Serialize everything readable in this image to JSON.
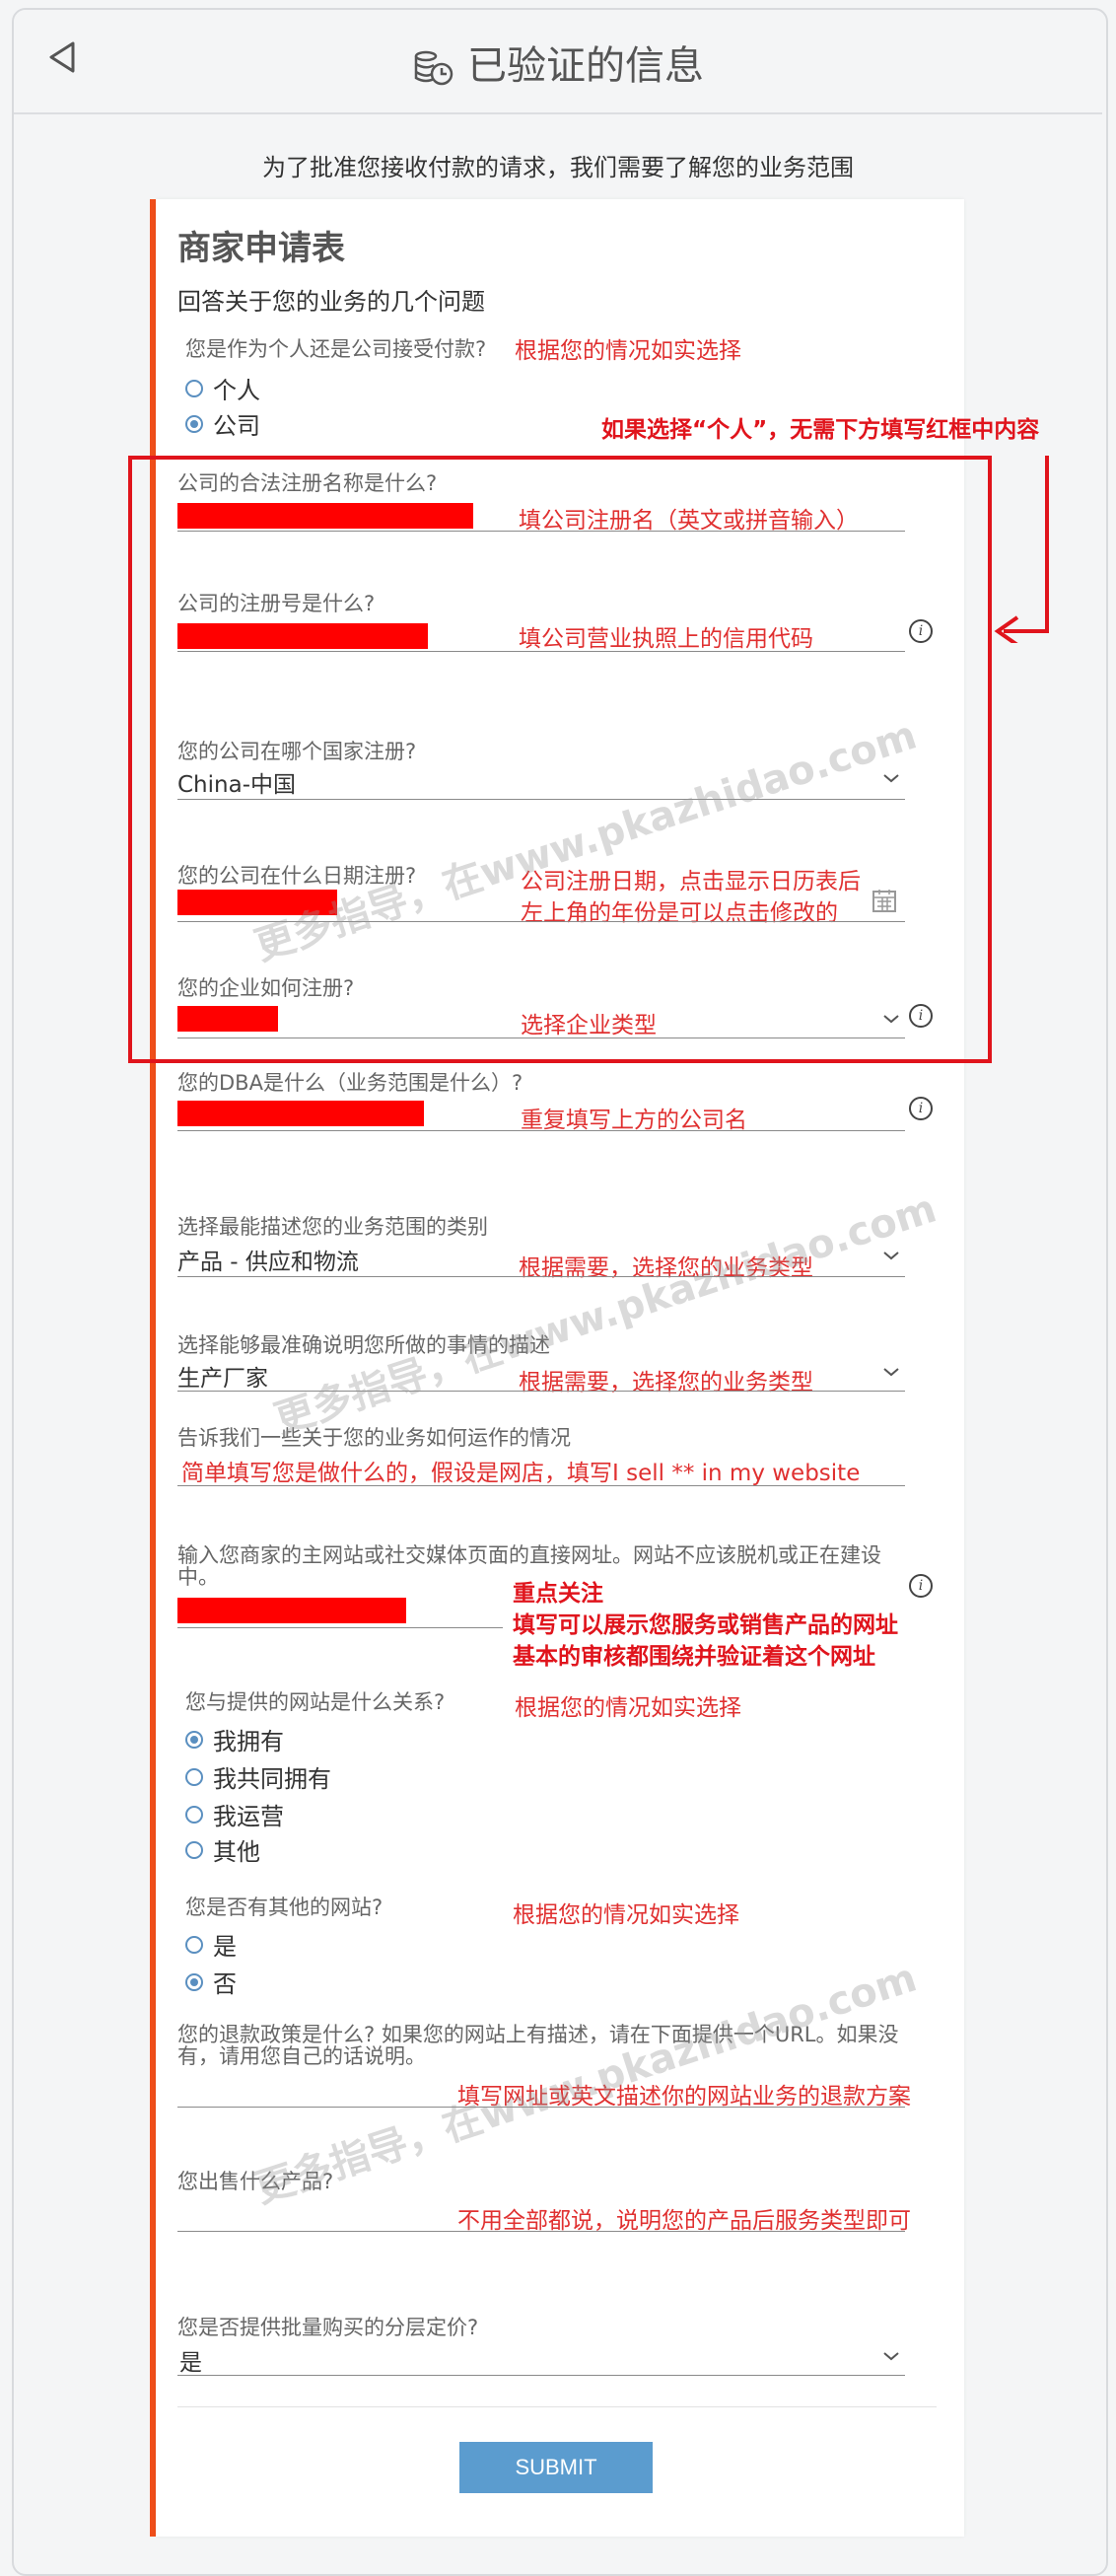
{
  "header": {
    "title": "已验证的信息"
  },
  "subtitle": "为了批准您接收付款的请求，我们需要了解您的业务范围",
  "form": {
    "title": "商家申请表",
    "subtitle": "回答关于您的业务的几个问题",
    "q_account_type": "您是作为个人还是公司接受付款?",
    "note_account_type": "根据您的情况如实选择",
    "opt_individual": "个人",
    "opt_company": "公司",
    "note_redbox": "如果选择“个人”，无需下方填写红框中内容",
    "q_legal_name": "公司的合法注册名称是什么?",
    "note_legal_name": "填公司注册名（英文或拼音输入）",
    "q_reg_number": "公司的注册号是什么?",
    "note_reg_number": "填公司营业执照上的信用代码",
    "q_country": "您的公司在哪个国家注册?",
    "country_value": "China-中国",
    "q_date": "您的公司在什么日期注册?",
    "note_date_1": "公司注册日期，点击显示日历表后",
    "note_date_2": "左上角的年份是可以点击修改的",
    "q_entity": "您的企业如何注册?",
    "note_entity": "选择企业类型",
    "q_dba": "您的DBA是什么（业务范围是什么）?",
    "note_dba": "重复填写上方的公司名",
    "q_category": "选择最能描述您的业务范围的类别",
    "category_value": "产品 - 供应和物流",
    "note_category": "根据需要，选择您的业务类型",
    "q_subcategory": "选择能够最准确说明您所做的事情的描述",
    "subcategory_value": "生产厂家",
    "note_subcategory": "根据需要，选择您的业务类型",
    "q_operation": "告诉我们一些关于您的业务如何运作的情况",
    "note_operation": "简单填写您是做什么的，假设是网店，填写I sell ** in my website",
    "q_website": "输入您商家的主网站或社交媒体页面的直接网址。网站不应该脱机或正在建设中。",
    "note_website_1": "重点关注",
    "note_website_2": "填写可以展示您服务或销售产品的网址",
    "note_website_3": "基本的审核都围绕并验证着这个网址",
    "q_relation": "您与提供的网站是什么关系?",
    "note_relation": "根据您的情况如实选择",
    "rel_opts": [
      "我拥有",
      "我共同拥有",
      "我运营",
      "其他"
    ],
    "q_other_sites": "您是否有其他的网站?",
    "note_other_sites": "根据您的情况如实选择",
    "other_opts": [
      "是",
      "否"
    ],
    "q_refund": "您的退款政策是什么? 如果您的网站上有描述，请在下面提供一个URL。如果没有，请用您自己的话说明。",
    "note_refund": "填写网址或英文描述你的网站业务的退款方案",
    "q_products": "您出售什么产品?",
    "note_products": "不用全部都说，说明您的产品后服务类型即可",
    "q_tiered": "您是否提供批量购买的分层定价?",
    "tiered_value": "是",
    "submit_label": "SUBMIT"
  },
  "watermarks": [
    "更多指导，在www.pkazhidao.com",
    "更多指导，在www.pkazhidao.com",
    "更多指导，在www.pkazhidao.com"
  ],
  "colors": {
    "accent_bar": "#f04e1a",
    "annotation_red": "#e0141c",
    "button": "#5b9ccf",
    "radio": "#5a8fc0"
  }
}
